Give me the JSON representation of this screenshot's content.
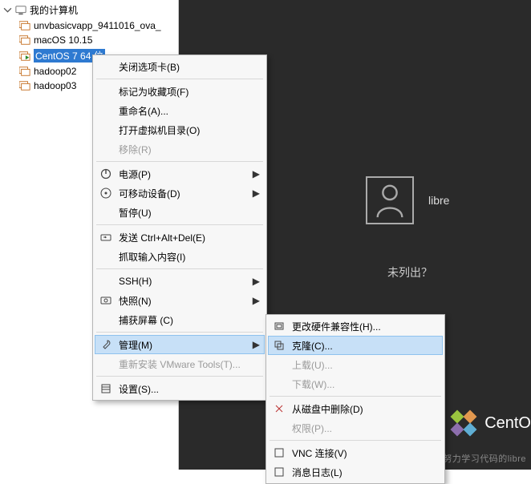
{
  "tree": {
    "root": "我的计算机",
    "items": [
      {
        "label": "unvbasicvapp_9411016_ova_"
      },
      {
        "label": "macOS 10.15"
      },
      {
        "label": "CentOS 7 64 位"
      },
      {
        "label": "hadoop02"
      },
      {
        "label": "hadoop03"
      }
    ]
  },
  "desktop": {
    "user_name": "libre",
    "unlisted": "未列出？",
    "distro": "CentO"
  },
  "watermark": "CSDN @一个努力学习代码的libre",
  "menu": {
    "close_tab": "关闭选项卡(B)",
    "mark_favorite": "标记为收藏项(F)",
    "rename": "重命名(A)...",
    "open_vm_dir": "打开虚拟机目录(O)",
    "remove": "移除(R)",
    "power": "电源(P)",
    "removable": "可移动设备(D)",
    "pause": "暂停(U)",
    "send_cad": "发送 Ctrl+Alt+Del(E)",
    "grab_input": "抓取输入内容(I)",
    "ssh": "SSH(H)",
    "snapshot": "快照(N)",
    "capture_screen": "捕获屏幕 (C)",
    "manage": "管理(M)",
    "reinstall_tools": "重新安装 VMware Tools(T)...",
    "settings": "设置(S)..."
  },
  "submenu": {
    "change_compat": "更改硬件兼容性(H)...",
    "clone": "克隆(C)...",
    "upload": "上载(U)...",
    "download": "下载(W)...",
    "delete_from_disk": "从磁盘中删除(D)",
    "permissions": "权限(P)...",
    "vnc_connect": "VNC 连接(V)",
    "message_log": "消息日志(L)"
  }
}
